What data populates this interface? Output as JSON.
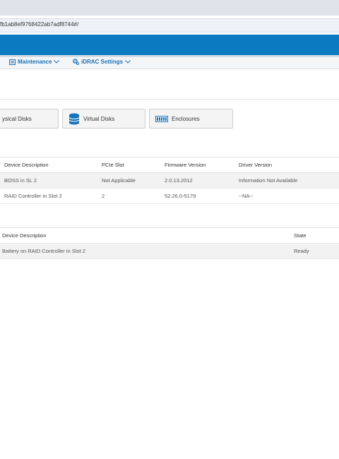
{
  "browser": {
    "url": "fb1ab8ef9768422ab7adf8744#/"
  },
  "menu": {
    "items": [
      {
        "label": "Maintenance",
        "icon": "wrench-list-icon"
      },
      {
        "label": "iDRAC Settings",
        "icon": "gear-icon"
      }
    ]
  },
  "tabs": {
    "physical": "ysical Disks",
    "virtual": "Virtual Disks",
    "enclosures": "Enclosures"
  },
  "controllers_table": {
    "headers": [
      "Device Description",
      "PCIe Slot",
      "Firmware Version",
      "Driver Version"
    ],
    "rows": [
      [
        "BOSS in SL 2",
        "Not Applicable",
        "2.0.13.2012",
        "Information Not Available"
      ],
      [
        "RAID Controller in Slot 2",
        "2",
        "52.26.0-5179",
        "--NA--"
      ]
    ]
  },
  "batteries_table": {
    "headers": [
      "Device Description",
      "State"
    ],
    "rows": [
      [
        "Battery on RAID Controller in Slot 2",
        "Ready"
      ]
    ]
  },
  "colors": {
    "banner": "#0b7ac0",
    "link": "#1a73b8"
  }
}
